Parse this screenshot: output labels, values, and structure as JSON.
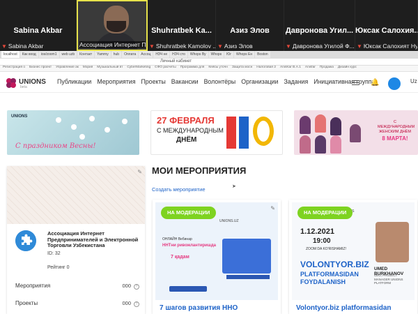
{
  "video_call": {
    "tiles": [
      {
        "name": "Sabina Akbar",
        "label": "Sabina Akbar"
      },
      {
        "name": "",
        "label": "Ассоциация Интернет П..."
      },
      {
        "name": "Shuhratbek Ka...",
        "label": "Shuhratbek Kamolov ..."
      },
      {
        "name": "Азиз Элов",
        "label": "Азиз Элов"
      },
      {
        "name": "Давронова Угил...",
        "label": "Давронова Угилой Ф..."
      },
      {
        "name": "Юксак Салохия...",
        "label": "Юксак Салохият Ну..."
      }
    ]
  },
  "browser": {
    "tabs": [
      "localhost",
      "Как вход",
      "ios/zoom1",
      "web uzb",
      "Контакт",
      "Yammy",
      "hub",
      "Оплата",
      "Ассоц",
      "НЗЧ не",
      "НЗЧ сто",
      "Whops Ву",
      "Whops",
      "Юг",
      "Whops Ен",
      "Boston"
    ],
    "address": "Личный кабинет",
    "bookmarks": [
      "Регистрация о",
      "Бизнес проект",
      "Управление ак",
      "Мэрия",
      "Музыкальный вт",
      "CyberMarketing",
      "СФО расчеты",
      "Программа для",
      "Кейсы уточн",
      "Защита мосн",
      "Налоговая 2",
      "AnisKar В.А.1",
      "Anisfar",
      "Продажа",
      "Дизайн курс"
    ]
  },
  "site": {
    "logo": {
      "name": "UNIONS",
      "tagline": "beta"
    },
    "menu": [
      "Публикации",
      "Мероприятия",
      "Проекты",
      "Вакансии",
      "Волонтёры",
      "Организации",
      "Задания",
      "Инициативная группа"
    ],
    "user_initial": "Uz",
    "banners": {
      "spring": {
        "brand": "UNIONS",
        "text": "С праздником Весны!"
      },
      "nno": {
        "date": "27 ФЕВРАЛЯ",
        "line1": "С МЕЖДУНАРОДНЫМ",
        "line2": "ДНЁМ"
      },
      "march8": {
        "text": "С МЕЖДУНАРОДНЫМ ЖЕНСКИМ ДНЁМ",
        "big": "8 МАРТА!"
      }
    },
    "organization": {
      "name": "Ассоциация Интернет Предпринимателей и Электронной Торговли Узбекистана",
      "id": "ID: 32",
      "rating": "Рейтинг 0",
      "rows": [
        {
          "label": "Мероприятия",
          "value": "000"
        },
        {
          "label": "Проекты",
          "value": "000"
        }
      ]
    },
    "events_section": {
      "title": "МОИ МЕРОПРИЯТИЯ",
      "create_link": "Создать мероприятие",
      "cards": [
        {
          "status": "НА МОДЕРАЦИИ",
          "poster_brand": "UNIONS.UZ",
          "poster_line1": "ОНЛАЙН Вебинар",
          "poster_line2": "ННТни ривожлантиришда",
          "poster_line3": "7 қадам",
          "title": "7 шагов развития ННО"
        },
        {
          "status": "НА МОДЕРАЦИИ",
          "poster_brand": "UNIONS",
          "date": "1.12.2021",
          "time": "19:00",
          "platform": "ZOOM DA KO'RISHAMIZ!",
          "headline": "VOLONTYOR.BIZ",
          "subline": "PLATFORMASIDAN FOYDALANISH",
          "speaker_name": "UMED BURKHANOV",
          "speaker_role": "CEO, PROJECT MANAGER UNIONS PLATFORM",
          "title": "Volontyor.biz platformasidan"
        }
      ]
    }
  }
}
